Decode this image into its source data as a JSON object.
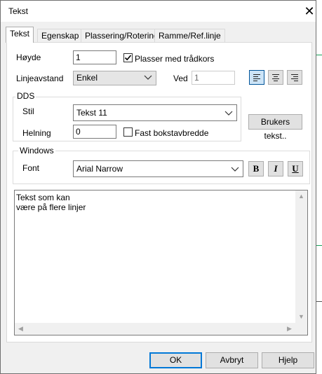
{
  "dialog": {
    "title": "Tekst",
    "close_glyph": "✕"
  },
  "tabs": [
    {
      "label": "Tekst",
      "active": true
    },
    {
      "label": "Egenskap"
    },
    {
      "label": "Plassering/Rotering"
    },
    {
      "label": "Ramme/Ref.linje"
    }
  ],
  "form": {
    "height_label": "Høyde",
    "height_value": "1",
    "crosshair_label": "Plasser med trådkors",
    "crosshair_checked": true,
    "spacing_label": "Linjeavstand",
    "spacing_value": "Enkel",
    "at_label": "Ved",
    "at_value": "1"
  },
  "alignment": {
    "options": [
      "align-left-icon",
      "align-center-icon",
      "align-right-icon"
    ],
    "selected": "align-left-icon"
  },
  "dds": {
    "legend": "DDS",
    "style_label": "Stil",
    "style_value": "Tekst 11",
    "user_text_button": "Brukers tekst..",
    "slant_label": "Helning",
    "slant_value": "0",
    "fixed_width_label": "Fast bokstavbredde",
    "fixed_width_checked": false
  },
  "windows": {
    "legend": "Windows",
    "font_label": "Font",
    "font_value": "Arial Narrow",
    "bold_label": "B",
    "italic_label": "I",
    "underline_label": "U"
  },
  "text_content": {
    "line1": "Tekst som kan",
    "line2": "være på flere linjer"
  },
  "buttons": {
    "ok": "OK",
    "cancel": "Avbryt",
    "help": "Hjelp"
  },
  "colors": {
    "accent": "#0078d7",
    "selected_bg": "#cce4f7"
  }
}
